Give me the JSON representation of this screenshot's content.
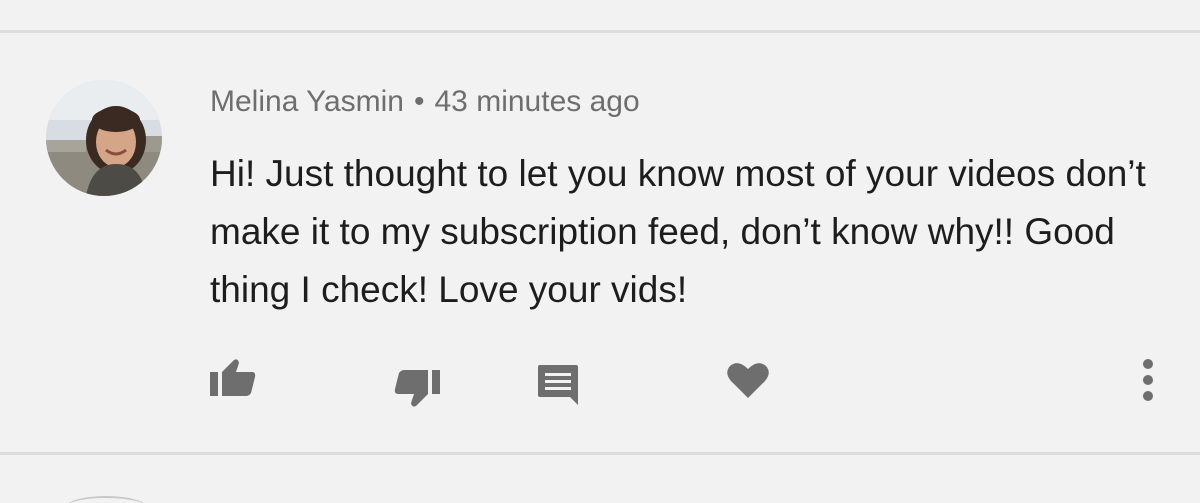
{
  "comment": {
    "author": "Melina Yasmin",
    "separator": "•",
    "timestamp": "43 minutes ago",
    "text": "Hi! Just thought to let you know most of your videos don’t make it to my subscription feed, don’t know why!! Good thing I check! Love your vids!"
  },
  "actions": {
    "like_icon": "thumbs-up-icon",
    "dislike_icon": "thumbs-down-icon",
    "reply_icon": "comment-icon",
    "heart_icon": "heart-icon",
    "more_icon": "more-vert-icon"
  },
  "colors": {
    "background": "#f2f2f2",
    "icon": "#6e6e6e",
    "text_primary": "#1d1d1d",
    "text_secondary": "#6e6e6e"
  }
}
